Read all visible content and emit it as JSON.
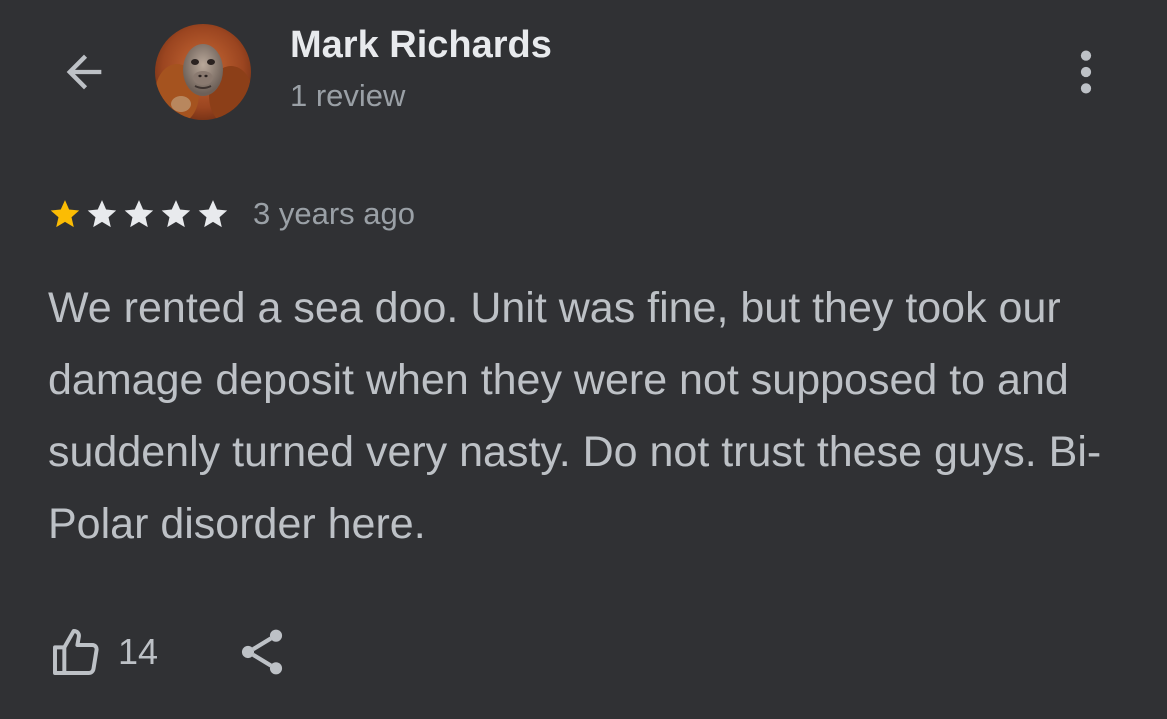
{
  "header": {
    "back_icon": "arrow-back-icon",
    "reviewer_name": "Mark Richards",
    "review_count": "1 review",
    "more_icon": "more-vert-icon"
  },
  "review": {
    "rating": 1,
    "max_rating": 5,
    "star_filled_color": "#fbbc04",
    "star_empty_color": "#e8eaed",
    "time": "3 years ago",
    "text": "We rented a sea doo. Unit was fine, but they took our damage deposit when they were not supposed to and suddenly turned very nasty. Do not trust these guys. Bi-Polar disorder here."
  },
  "actions": {
    "like_icon": "thumb-up-icon",
    "like_count": "14",
    "share_icon": "share-icon"
  },
  "colors": {
    "background": "#303134",
    "primary_text": "#e8eaed",
    "secondary_text": "#9aa0a6",
    "body_text": "#bdc1c6"
  }
}
